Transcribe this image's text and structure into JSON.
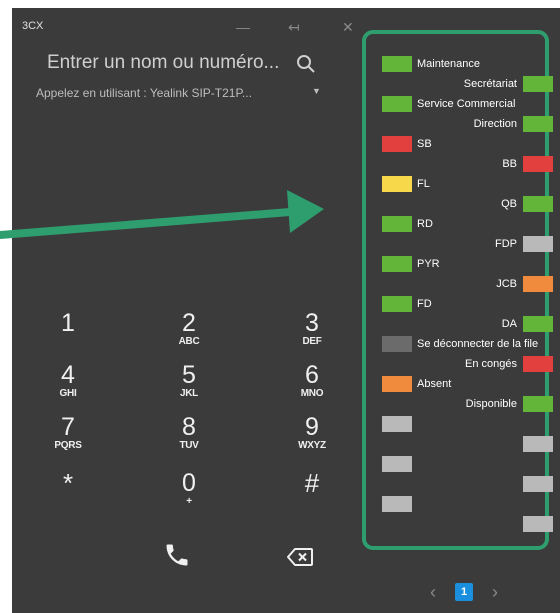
{
  "window": {
    "logo": "3CX",
    "minimize": "—",
    "dock": "↤",
    "close": "✕"
  },
  "search": {
    "placeholder": "Entrer un nom ou numéro..."
  },
  "call_with": {
    "label": "Appelez en utilisant : Yealink SIP-T21P..."
  },
  "keypad": [
    {
      "digit": "1",
      "letters": ""
    },
    {
      "digit": "2",
      "letters": "ABC"
    },
    {
      "digit": "3",
      "letters": "DEF"
    },
    {
      "digit": "4",
      "letters": "GHI"
    },
    {
      "digit": "5",
      "letters": "JKL"
    },
    {
      "digit": "6",
      "letters": "MNO"
    },
    {
      "digit": "7",
      "letters": "PQRS"
    },
    {
      "digit": "8",
      "letters": "TUV"
    },
    {
      "digit": "9",
      "letters": "WXYZ"
    },
    {
      "digit": "*",
      "letters": ""
    },
    {
      "digit": "0",
      "letters": "+"
    },
    {
      "digit": "#",
      "letters": ""
    }
  ],
  "pager": {
    "current_page": "1",
    "prev": "‹",
    "next": "›"
  },
  "colors": {
    "green": "#63b53a",
    "red": "#e23f3f",
    "yellow": "#f6d84a",
    "orange": "#f08a3c",
    "dark_gray": "#6b6b6b",
    "light_gray": "#b9b9b9",
    "accent_blue": "#1a8fe0",
    "annotation_teal": "#2e9e6f"
  },
  "blf_keys": [
    {
      "label": "Maintenance",
      "color": "#63b53a",
      "side": "left"
    },
    {
      "label": "Secrétariat",
      "color": "#63b53a",
      "side": "right"
    },
    {
      "label": "Service Commercial",
      "color": "#63b53a",
      "side": "left"
    },
    {
      "label": "Direction",
      "color": "#63b53a",
      "side": "right"
    },
    {
      "label": "SB",
      "color": "#e23f3f",
      "side": "left"
    },
    {
      "label": "BB",
      "color": "#e23f3f",
      "side": "right"
    },
    {
      "label": "FL",
      "color": "#f6d84a",
      "side": "left"
    },
    {
      "label": "QB",
      "color": "#63b53a",
      "side": "right"
    },
    {
      "label": "RD",
      "color": "#63b53a",
      "side": "left"
    },
    {
      "label": "FDP",
      "color": "#b9b9b9",
      "side": "right"
    },
    {
      "label": "PYR",
      "color": "#63b53a",
      "side": "left"
    },
    {
      "label": "JCB",
      "color": "#f08a3c",
      "side": "right"
    },
    {
      "label": "FD",
      "color": "#63b53a",
      "side": "left"
    },
    {
      "label": "DA",
      "color": "#63b53a",
      "side": "right"
    },
    {
      "label": "Se déconnecter de la file",
      "color": "#6b6b6b",
      "side": "left"
    },
    {
      "label": "En congés",
      "color": "#e23f3f",
      "side": "right"
    },
    {
      "label": "Absent",
      "color": "#f08a3c",
      "side": "left"
    },
    {
      "label": "Disponible",
      "color": "#63b53a",
      "side": "right"
    },
    {
      "label": "",
      "color": "#b9b9b9",
      "side": "left"
    },
    {
      "label": "",
      "color": "#b9b9b9",
      "side": "right"
    },
    {
      "label": "",
      "color": "#b9b9b9",
      "side": "left"
    },
    {
      "label": "",
      "color": "#b9b9b9",
      "side": "right"
    },
    {
      "label": "",
      "color": "#b9b9b9",
      "side": "left"
    },
    {
      "label": "",
      "color": "#b9b9b9",
      "side": "right"
    }
  ]
}
